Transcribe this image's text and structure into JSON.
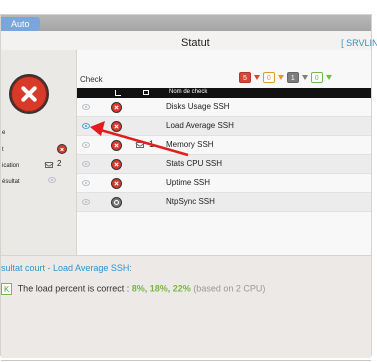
{
  "top_tab": {
    "label": "Auto"
  },
  "header": {
    "title": "Statut",
    "server": "[ SRVLINI"
  },
  "left_panel": {
    "label_a": "e",
    "label_b": "t",
    "label_c": "ication",
    "label_d": "ésultat",
    "notification_count": "2"
  },
  "table": {
    "title": "Check",
    "header_name": "Nom de check",
    "badges": {
      "critical": "5",
      "warning": "0",
      "unknown": "1",
      "ok": "0"
    },
    "rows": [
      {
        "eye_color": "gray",
        "status": "critical",
        "name": "Disks Usage SSH"
      },
      {
        "eye_color": "blue",
        "status": "critical",
        "name": "Load Average SSH"
      },
      {
        "eye_color": "gray",
        "status": "critical",
        "mail_count": "1",
        "name": "Memory SSH"
      },
      {
        "eye_color": "gray",
        "status": "critical",
        "name": "Stats CPU SSH"
      },
      {
        "eye_color": "gray",
        "status": "critical",
        "name": "Uptime SSH"
      },
      {
        "eye_color": "gray",
        "status": "unknown",
        "name": "NtpSync SSH"
      }
    ]
  },
  "result": {
    "title": "sultat court - Load Average SSH:",
    "badge": "K",
    "text_prefix": "The load percent is correct : ",
    "values": "8%, 18%, 22%",
    "text_suffix": " (based on 2 CPU)"
  },
  "colors": {
    "accent_blue": "#2f93cc",
    "critical_red": "#d83a2a",
    "ok_green": "#76b946",
    "warning_orange": "#e29a2d",
    "arrow_red": "#e11d1d"
  }
}
